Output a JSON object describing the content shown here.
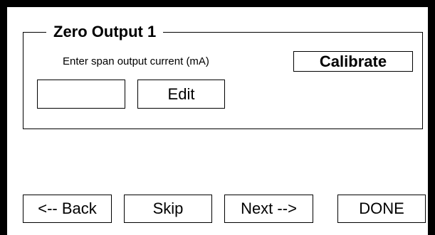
{
  "group": {
    "title": "Zero Output 1",
    "prompt": "Enter span output current (mA)"
  },
  "input": {
    "value": ""
  },
  "buttons": {
    "calibrate": "Calibrate",
    "edit": "Edit",
    "back": "<-- Back",
    "skip": "Skip",
    "next": "Next -->",
    "done": "DONE"
  }
}
